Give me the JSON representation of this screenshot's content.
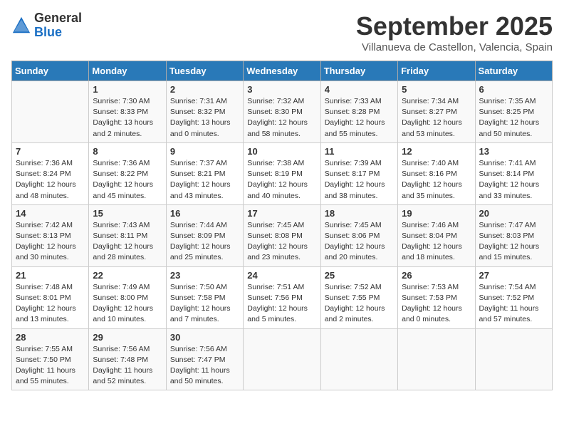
{
  "header": {
    "logo_general": "General",
    "logo_blue": "Blue",
    "month_title": "September 2025",
    "location": "Villanueva de Castellon, Valencia, Spain"
  },
  "days_of_week": [
    "Sunday",
    "Monday",
    "Tuesday",
    "Wednesday",
    "Thursday",
    "Friday",
    "Saturday"
  ],
  "weeks": [
    [
      {
        "day": "",
        "info": ""
      },
      {
        "day": "1",
        "info": "Sunrise: 7:30 AM\nSunset: 8:33 PM\nDaylight: 13 hours\nand 2 minutes."
      },
      {
        "day": "2",
        "info": "Sunrise: 7:31 AM\nSunset: 8:32 PM\nDaylight: 13 hours\nand 0 minutes."
      },
      {
        "day": "3",
        "info": "Sunrise: 7:32 AM\nSunset: 8:30 PM\nDaylight: 12 hours\nand 58 minutes."
      },
      {
        "day": "4",
        "info": "Sunrise: 7:33 AM\nSunset: 8:28 PM\nDaylight: 12 hours\nand 55 minutes."
      },
      {
        "day": "5",
        "info": "Sunrise: 7:34 AM\nSunset: 8:27 PM\nDaylight: 12 hours\nand 53 minutes."
      },
      {
        "day": "6",
        "info": "Sunrise: 7:35 AM\nSunset: 8:25 PM\nDaylight: 12 hours\nand 50 minutes."
      }
    ],
    [
      {
        "day": "7",
        "info": "Sunrise: 7:36 AM\nSunset: 8:24 PM\nDaylight: 12 hours\nand 48 minutes."
      },
      {
        "day": "8",
        "info": "Sunrise: 7:36 AM\nSunset: 8:22 PM\nDaylight: 12 hours\nand 45 minutes."
      },
      {
        "day": "9",
        "info": "Sunrise: 7:37 AM\nSunset: 8:21 PM\nDaylight: 12 hours\nand 43 minutes."
      },
      {
        "day": "10",
        "info": "Sunrise: 7:38 AM\nSunset: 8:19 PM\nDaylight: 12 hours\nand 40 minutes."
      },
      {
        "day": "11",
        "info": "Sunrise: 7:39 AM\nSunset: 8:17 PM\nDaylight: 12 hours\nand 38 minutes."
      },
      {
        "day": "12",
        "info": "Sunrise: 7:40 AM\nSunset: 8:16 PM\nDaylight: 12 hours\nand 35 minutes."
      },
      {
        "day": "13",
        "info": "Sunrise: 7:41 AM\nSunset: 8:14 PM\nDaylight: 12 hours\nand 33 minutes."
      }
    ],
    [
      {
        "day": "14",
        "info": "Sunrise: 7:42 AM\nSunset: 8:13 PM\nDaylight: 12 hours\nand 30 minutes."
      },
      {
        "day": "15",
        "info": "Sunrise: 7:43 AM\nSunset: 8:11 PM\nDaylight: 12 hours\nand 28 minutes."
      },
      {
        "day": "16",
        "info": "Sunrise: 7:44 AM\nSunset: 8:09 PM\nDaylight: 12 hours\nand 25 minutes."
      },
      {
        "day": "17",
        "info": "Sunrise: 7:45 AM\nSunset: 8:08 PM\nDaylight: 12 hours\nand 23 minutes."
      },
      {
        "day": "18",
        "info": "Sunrise: 7:45 AM\nSunset: 8:06 PM\nDaylight: 12 hours\nand 20 minutes."
      },
      {
        "day": "19",
        "info": "Sunrise: 7:46 AM\nSunset: 8:04 PM\nDaylight: 12 hours\nand 18 minutes."
      },
      {
        "day": "20",
        "info": "Sunrise: 7:47 AM\nSunset: 8:03 PM\nDaylight: 12 hours\nand 15 minutes."
      }
    ],
    [
      {
        "day": "21",
        "info": "Sunrise: 7:48 AM\nSunset: 8:01 PM\nDaylight: 12 hours\nand 13 minutes."
      },
      {
        "day": "22",
        "info": "Sunrise: 7:49 AM\nSunset: 8:00 PM\nDaylight: 12 hours\nand 10 minutes."
      },
      {
        "day": "23",
        "info": "Sunrise: 7:50 AM\nSunset: 7:58 PM\nDaylight: 12 hours\nand 7 minutes."
      },
      {
        "day": "24",
        "info": "Sunrise: 7:51 AM\nSunset: 7:56 PM\nDaylight: 12 hours\nand 5 minutes."
      },
      {
        "day": "25",
        "info": "Sunrise: 7:52 AM\nSunset: 7:55 PM\nDaylight: 12 hours\nand 2 minutes."
      },
      {
        "day": "26",
        "info": "Sunrise: 7:53 AM\nSunset: 7:53 PM\nDaylight: 12 hours\nand 0 minutes."
      },
      {
        "day": "27",
        "info": "Sunrise: 7:54 AM\nSunset: 7:52 PM\nDaylight: 11 hours\nand 57 minutes."
      }
    ],
    [
      {
        "day": "28",
        "info": "Sunrise: 7:55 AM\nSunset: 7:50 PM\nDaylight: 11 hours\nand 55 minutes."
      },
      {
        "day": "29",
        "info": "Sunrise: 7:56 AM\nSunset: 7:48 PM\nDaylight: 11 hours\nand 52 minutes."
      },
      {
        "day": "30",
        "info": "Sunrise: 7:56 AM\nSunset: 7:47 PM\nDaylight: 11 hours\nand 50 minutes."
      },
      {
        "day": "",
        "info": ""
      },
      {
        "day": "",
        "info": ""
      },
      {
        "day": "",
        "info": ""
      },
      {
        "day": "",
        "info": ""
      }
    ]
  ]
}
